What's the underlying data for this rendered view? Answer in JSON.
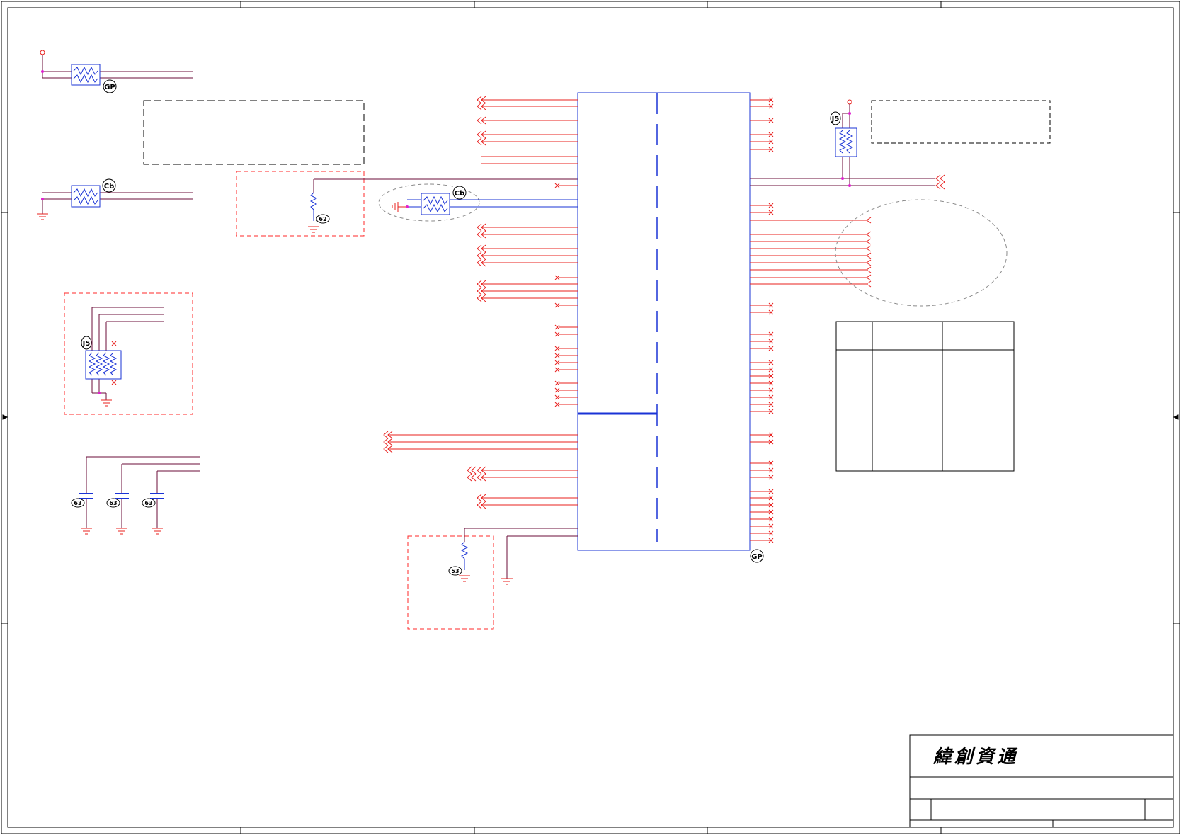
{
  "title_block": {
    "company_name": "緯創資通"
  },
  "badges": {
    "top_left_fuse": "GP",
    "mid_left_fuse": "Cb",
    "center_fuse": "Cb",
    "array_resistor": "J5",
    "right_pullup": "J5",
    "main_ic": "GP",
    "res_r1": "62",
    "res_r2": "53",
    "cap_c1": "63",
    "cap_c2": "63",
    "cap_c3": "63"
  },
  "colors": {
    "net": "#e8201e",
    "wire": "#6b0e3a",
    "component": "#1a33d6",
    "junction": "#e020d0",
    "border": "#000000",
    "highlight_box": "#ff2a2a",
    "note_circle": "#8a8a8a"
  }
}
